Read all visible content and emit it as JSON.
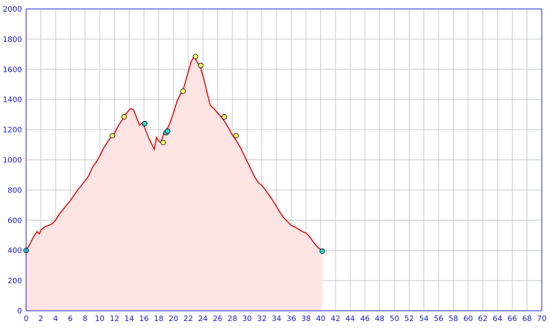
{
  "chart_data": {
    "type": "area",
    "title": "",
    "xlabel": "",
    "ylabel": "",
    "xlim": [
      0,
      70
    ],
    "ylim": [
      0,
      2000
    ],
    "grid": true,
    "x_ticks": [
      "0",
      "2",
      "4",
      "6",
      "8",
      "10",
      "12",
      "14",
      "16",
      "18",
      "20",
      "22",
      "24",
      "26",
      "28",
      "30",
      "32",
      "34",
      "36",
      "38",
      "40",
      "42",
      "44",
      "46",
      "48",
      "50",
      "52",
      "54",
      "56",
      "58",
      "60",
      "62",
      "64",
      "66",
      "68",
      "70"
    ],
    "y_ticks": [
      "0",
      "200",
      "400",
      "600",
      "800",
      "1000",
      "1200",
      "1400",
      "1600",
      "1800",
      "2000"
    ],
    "colors": {
      "line": "#e00000",
      "fill": "#ffe4e4",
      "grid": "#c8c8c8",
      "tick_text": "#1a1acc",
      "marker_yellow": "#ffff66",
      "marker_cyan": "#33dddd"
    },
    "series": [
      {
        "x": [
          0,
          0.5,
          1,
          1.5,
          1.8,
          2,
          2.5,
          3,
          3.5,
          4,
          4.5,
          5,
          5.5,
          6,
          6.5,
          7,
          7.5,
          8,
          8.5,
          9,
          9.5,
          10,
          10.5,
          11,
          11.5,
          12,
          12.5,
          13,
          13.3,
          13.8,
          14.2,
          14.6,
          15,
          15.4,
          15.8,
          16.2,
          16.6,
          17,
          17.4,
          17.7,
          18,
          18.3,
          18.7,
          19,
          19.2,
          19.5,
          20,
          20.5,
          21,
          21.3,
          21.7,
          22,
          22.4,
          22.8,
          23,
          23.3,
          23.6,
          24,
          24.5,
          25,
          25.5,
          26,
          26.5,
          27,
          27.5,
          28,
          28.5,
          29,
          29.5,
          30,
          30.5,
          31,
          31.5,
          32,
          32.5,
          33,
          33.5,
          34,
          34.5,
          35,
          35.5,
          36,
          36.5,
          37,
          37.5,
          38,
          38.5,
          39,
          39.5,
          40,
          40.2
        ],
        "y": [
          400,
          440,
          490,
          525,
          510,
          535,
          555,
          565,
          575,
          600,
          640,
          670,
          700,
          730,
          765,
          800,
          830,
          860,
          895,
          950,
          985,
          1025,
          1075,
          1115,
          1150,
          1175,
          1225,
          1260,
          1290,
          1320,
          1340,
          1330,
          1280,
          1230,
          1245,
          1200,
          1150,
          1110,
          1070,
          1150,
          1125,
          1115,
          1180,
          1200,
          1210,
          1240,
          1310,
          1390,
          1440,
          1460,
          1530,
          1580,
          1650,
          1685,
          1670,
          1640,
          1625,
          1560,
          1460,
          1360,
          1340,
          1310,
          1285,
          1250,
          1210,
          1165,
          1130,
          1090,
          1040,
          990,
          940,
          890,
          850,
          830,
          800,
          765,
          730,
          690,
          650,
          615,
          590,
          565,
          555,
          540,
          525,
          515,
          490,
          455,
          425,
          405,
          400
        ]
      }
    ],
    "markers": [
      {
        "x": 0,
        "y": 400,
        "color": "cyan"
      },
      {
        "x": 11.7,
        "y": 1160,
        "color": "yellow"
      },
      {
        "x": 13.3,
        "y": 1285,
        "color": "yellow"
      },
      {
        "x": 16.1,
        "y": 1240,
        "color": "cyan"
      },
      {
        "x": 18.6,
        "y": 1115,
        "color": "yellow"
      },
      {
        "x": 19,
        "y": 1180,
        "color": "cyan"
      },
      {
        "x": 19.2,
        "y": 1190,
        "color": "cyan"
      },
      {
        "x": 21.3,
        "y": 1455,
        "color": "yellow"
      },
      {
        "x": 23,
        "y": 1685,
        "color": "yellow"
      },
      {
        "x": 23.7,
        "y": 1625,
        "color": "yellow"
      },
      {
        "x": 26.9,
        "y": 1285,
        "color": "yellow"
      },
      {
        "x": 28.5,
        "y": 1160,
        "color": "yellow"
      },
      {
        "x": 40.2,
        "y": 395,
        "color": "cyan"
      }
    ]
  }
}
